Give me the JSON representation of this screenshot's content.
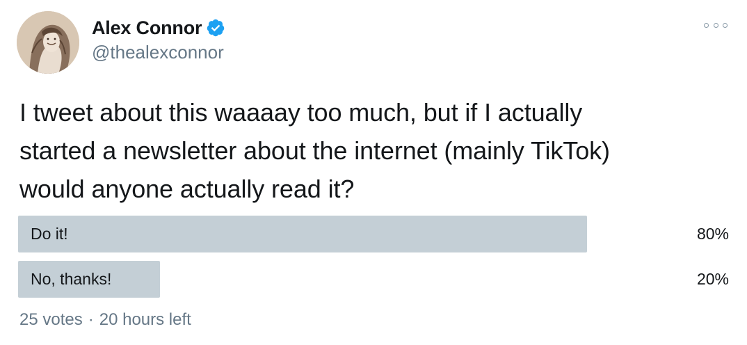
{
  "user": {
    "display_name": "Alex Connor",
    "handle": "@thealexconnor",
    "verified": true
  },
  "tweet": {
    "text_lines": [
      "I tweet about this waaaay too much, but if I actually",
      "started a newsletter about the internet (mainly TikTok)",
      "would anyone actually read it?"
    ]
  },
  "poll": {
    "options": [
      {
        "label": "Do it!",
        "percent_text": "80%",
        "fraction": 0.8
      },
      {
        "label": "No, thanks!",
        "percent_text": "20%",
        "fraction": 0.2
      }
    ],
    "votes_text": "25 votes",
    "separator": "·",
    "time_left_text": "20 hours left"
  },
  "icons": {
    "verified": "verified-badge-icon",
    "more": "more-options-icon"
  },
  "colors": {
    "verified_blue": "#1da1f2",
    "poll_bar": "#c4cfd6",
    "secondary_text": "#657786",
    "primary_text": "#14171a"
  }
}
